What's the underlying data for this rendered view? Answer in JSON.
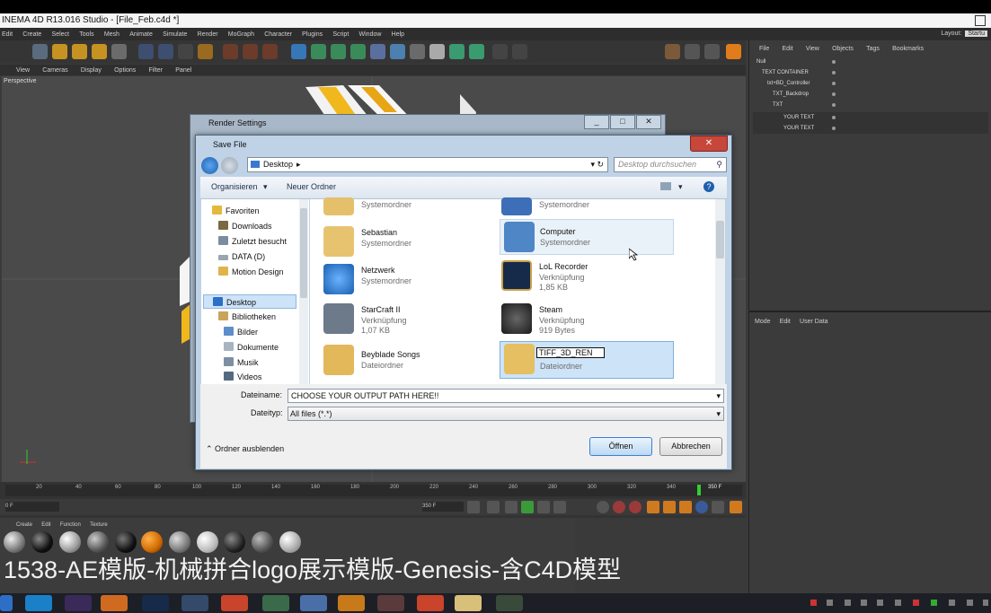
{
  "app": {
    "title": "INEMA 4D R13.016 Studio - [File_Feb.c4d *]",
    "menu": [
      "Edit",
      "Create",
      "Select",
      "Tools",
      "Mesh",
      "Animate",
      "Simulate",
      "Render",
      "MoGraph",
      "Character",
      "Plugins",
      "Script",
      "Window",
      "Help"
    ],
    "layout_label": "Layout:",
    "layout_value": "Startu"
  },
  "viewport": {
    "menu": [
      "View",
      "Cameras",
      "Display",
      "Options",
      "Filter",
      "Panel"
    ],
    "label": "Perspective"
  },
  "object_manager": {
    "menu": [
      "File",
      "Edit",
      "View",
      "Objects",
      "Tags",
      "Bookmarks"
    ],
    "objects": [
      "Null",
      "TEXT CONTAINER",
      "txt+BD_Controller",
      "TXT_Backdrop",
      "TXT",
      "YOUR TEXT",
      "YOUR TEXT"
    ]
  },
  "attributes": {
    "menu": [
      "Mode",
      "Edit",
      "User Data"
    ]
  },
  "timeline": {
    "ticks": [
      "20",
      "40",
      "60",
      "80",
      "100",
      "120",
      "140",
      "160",
      "180",
      "200",
      "220",
      "240",
      "260",
      "280",
      "300",
      "320",
      "340"
    ],
    "start_field": "0 F",
    "end_field": "350 F",
    "current": "350 F"
  },
  "materials": {
    "menu": [
      "Create",
      "Edit",
      "Function",
      "Texture"
    ]
  },
  "render_settings": {
    "title": "Render Settings"
  },
  "save_dialog": {
    "title": "Save File",
    "address": "Desktop",
    "search_placeholder": "Desktop durchsuchen",
    "toolbar": {
      "organize": "Organisieren",
      "new_folder": "Neuer Ordner"
    },
    "nav": [
      {
        "label": "Favoriten"
      },
      {
        "label": "Downloads"
      },
      {
        "label": "Zuletzt besucht"
      },
      {
        "label": "DATA (D)"
      },
      {
        "label": "Motion Design"
      },
      {
        "label": "Desktop"
      },
      {
        "label": "Bibliotheken"
      },
      {
        "label": "Bilder"
      },
      {
        "label": "Dokumente"
      },
      {
        "label": "Musik"
      },
      {
        "label": "Videos"
      }
    ],
    "files": [
      {
        "name": "",
        "sub": "Systemordner",
        "size": ""
      },
      {
        "name": "",
        "sub": "Systemordner",
        "size": ""
      },
      {
        "name": "Sebastian",
        "sub": "Systemordner",
        "size": ""
      },
      {
        "name": "Computer",
        "sub": "Systemordner",
        "size": ""
      },
      {
        "name": "Netzwerk",
        "sub": "Systemordner",
        "size": ""
      },
      {
        "name": "LoL Recorder",
        "sub": "Verknüpfung",
        "size": "1,85 KB"
      },
      {
        "name": "StarCraft II",
        "sub": "Verknüpfung",
        "size": "1,07 KB"
      },
      {
        "name": "Steam",
        "sub": "Verknüpfung",
        "size": "919 Bytes"
      },
      {
        "name": "Beyblade Songs",
        "sub": "Dateiordner",
        "size": ""
      },
      {
        "name": "TIFF_3D_REN",
        "sub": "Dateiordner",
        "size": ""
      }
    ],
    "filename_label": "Dateiname:",
    "filename_value": "CHOOSE YOUR OUTPUT PATH HERE!!",
    "filetype_label": "Dateityp:",
    "filetype_value": "All files (*.*)",
    "hide_folders": "Ordner ausblenden",
    "open_button": "Öffnen",
    "cancel_button": "Abbrechen"
  },
  "caption": "1538-AE模版-机械拼合logo展示模版-Genesis-含C4D模型",
  "colors": {
    "accent": "#3c7fd6",
    "selection": "#cde3f7",
    "close_red": "#c9463a"
  }
}
